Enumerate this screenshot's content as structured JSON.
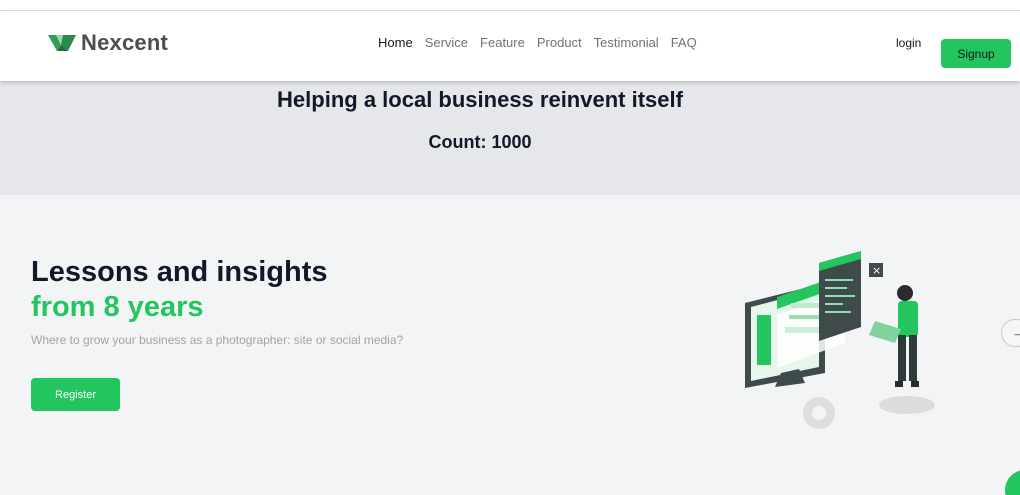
{
  "brand": {
    "name": "Nexcent",
    "accent": "#22c55e"
  },
  "nav": {
    "items": [
      "Home",
      "Service",
      "Feature",
      "Product",
      "Testimonial",
      "FAQ"
    ],
    "active": "Home"
  },
  "auth": {
    "login": "login",
    "signup": "Signup"
  },
  "banner": {
    "title": "Helping a local business reinvent itself",
    "count": "Count: 1000"
  },
  "hero": {
    "title_line1": "Lessons and insights",
    "title_line2": "from 8 years",
    "subtitle": "Where to grow your business as a photographer: site or social media?",
    "cta": "Register"
  },
  "icons": {
    "logo": "nexcent-logo-icon",
    "next": "arrow-right-icon",
    "illustration": "developer-illustration"
  }
}
